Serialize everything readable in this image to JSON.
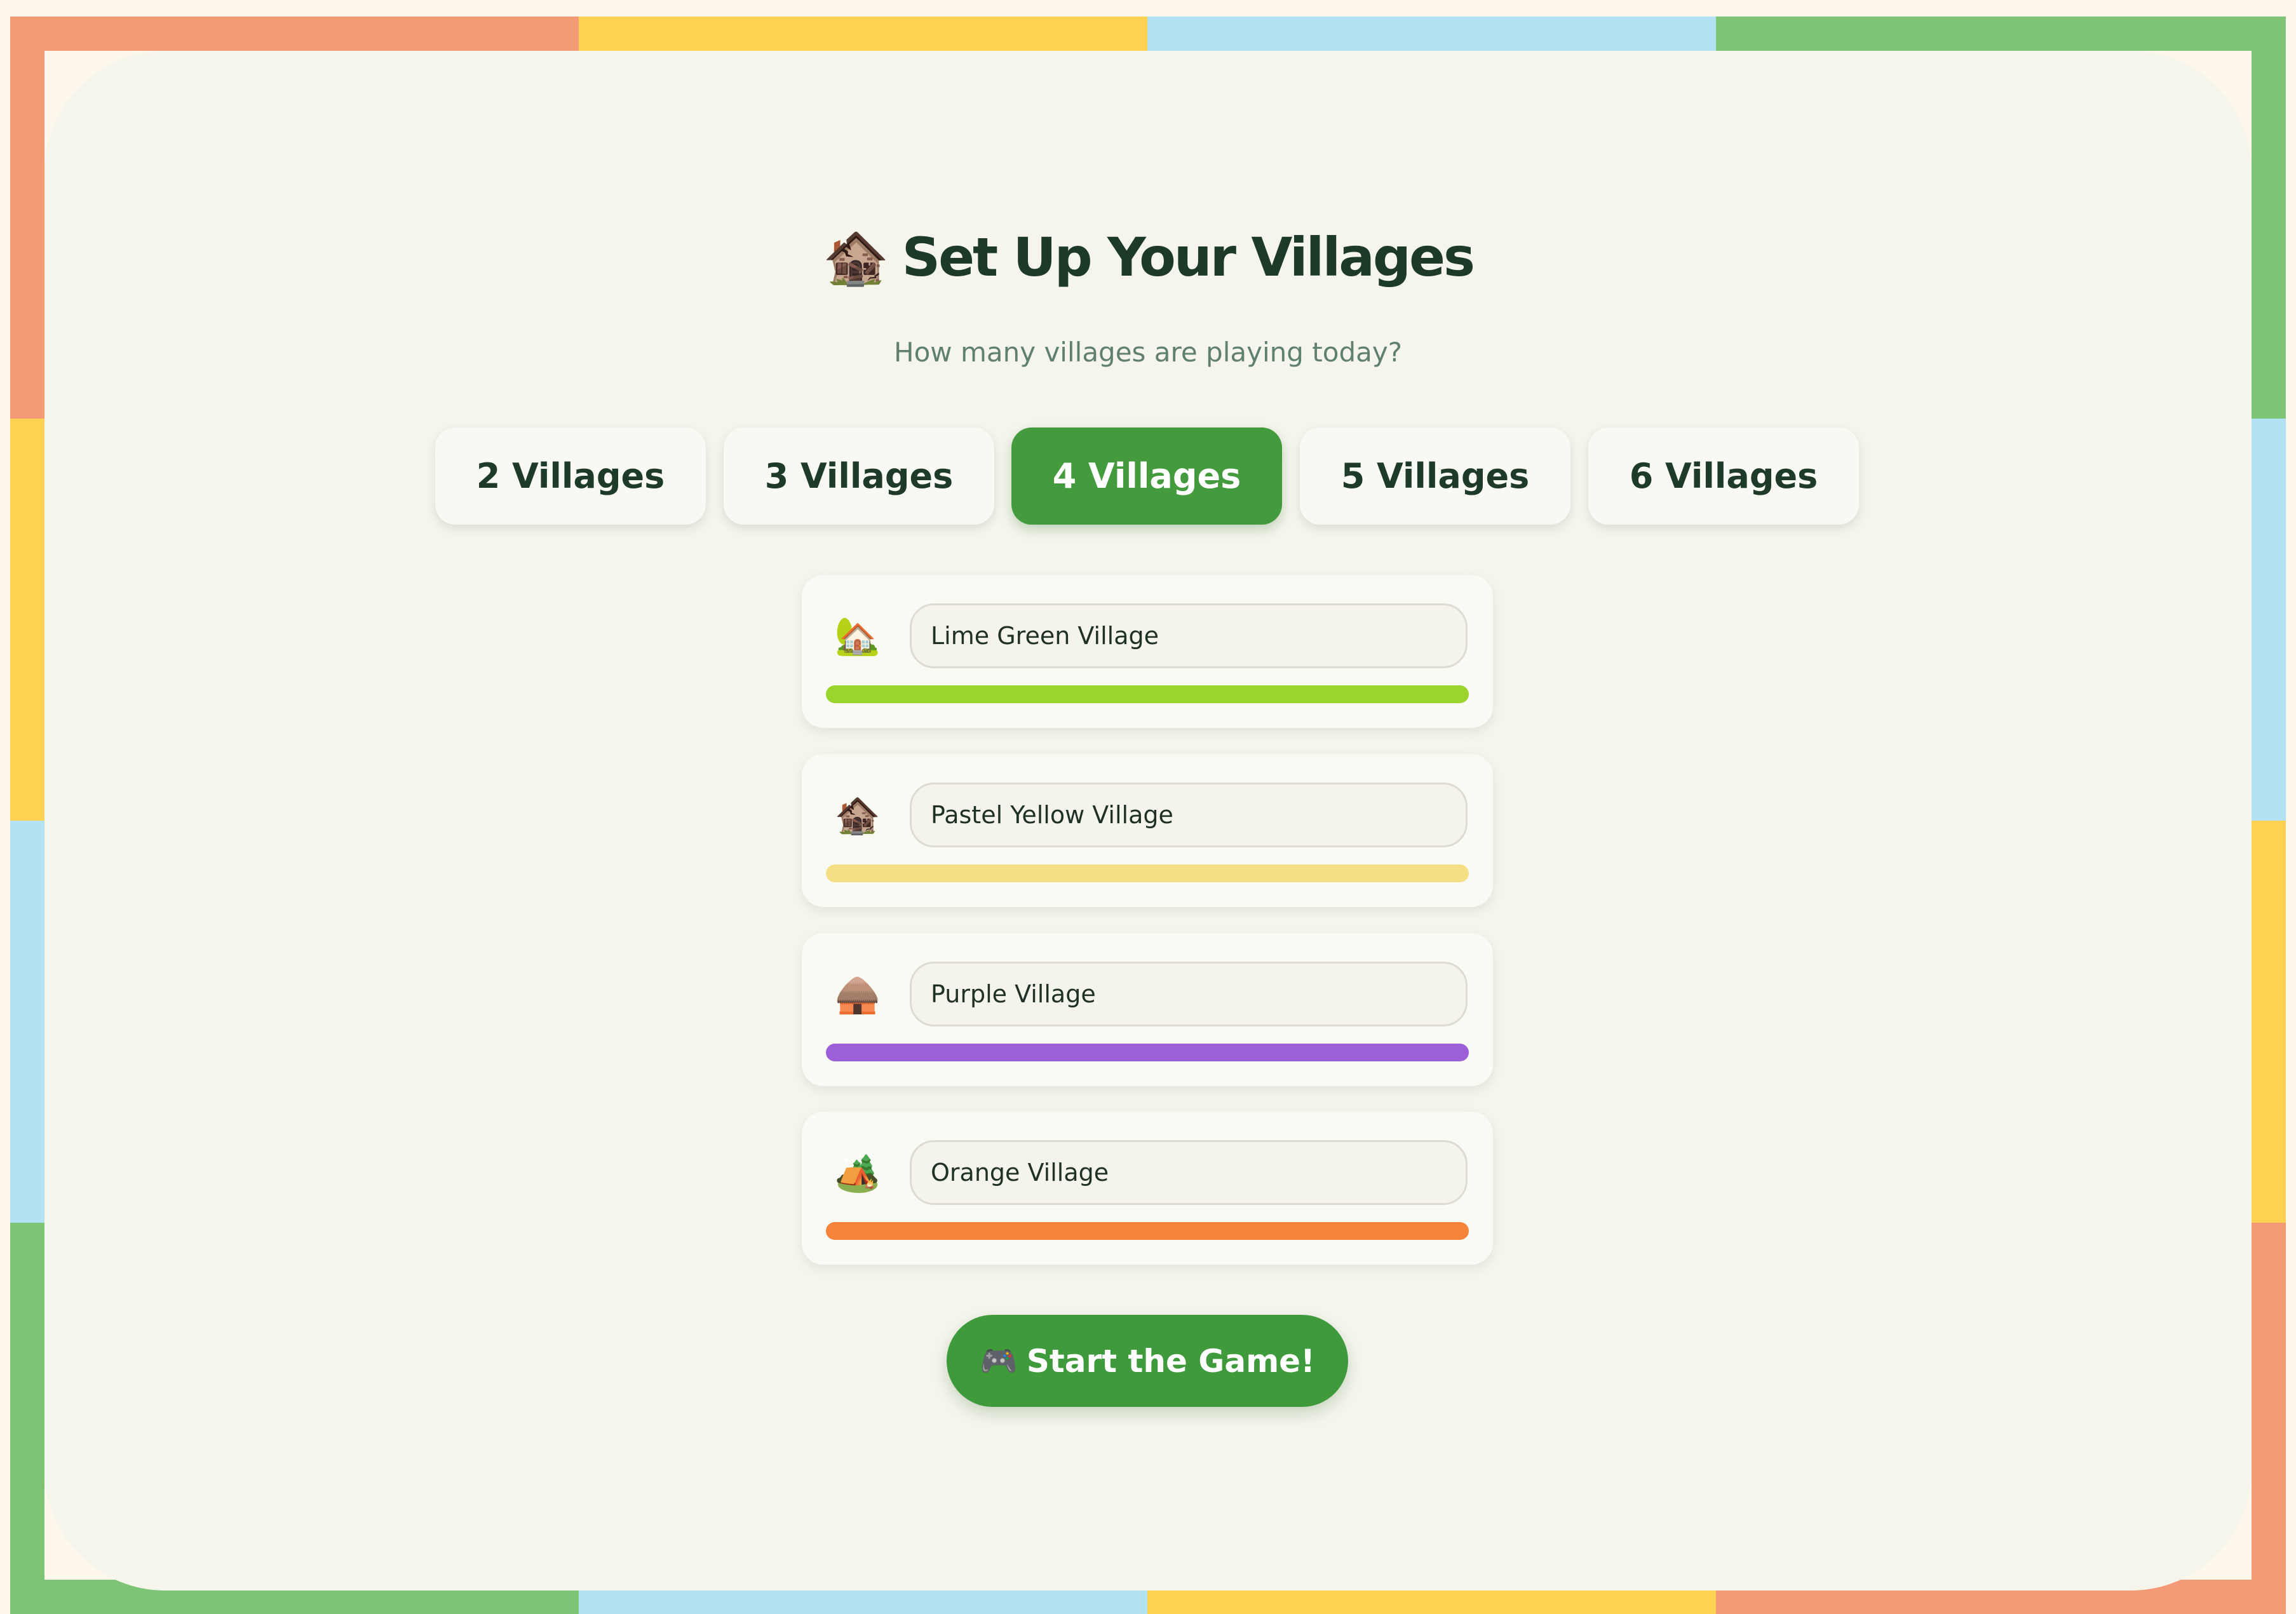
{
  "theme": {
    "coral": "#f59a76",
    "yellow": "#fdd253",
    "sky": "#b3e2f2",
    "green": "#7dc476",
    "panel": "#f5f5ec",
    "accent_green": "#439b3e"
  },
  "header": {
    "title_icon": "🏚️",
    "title": "Set Up Your Villages",
    "subtitle": "How many villages are playing today?"
  },
  "village_count": {
    "selected": "4 Villages",
    "options": [
      {
        "label": "2 Villages",
        "selected": false
      },
      {
        "label": "3 Villages",
        "selected": false
      },
      {
        "label": "4 Villages",
        "selected": true
      },
      {
        "label": "5 Villages",
        "selected": false
      },
      {
        "label": "6 Villages",
        "selected": false
      }
    ]
  },
  "villages": [
    {
      "icon": "🏡",
      "icon_name": "house-with-tree-icon",
      "name": "Lime Green Village",
      "color": "#9bd42c"
    },
    {
      "icon": "🏚️",
      "icon_name": "house-icon",
      "name": "Pastel Yellow Village",
      "color": "#f5df84"
    },
    {
      "icon": "🛖",
      "icon_name": "hut-icon",
      "name": "Purple Village",
      "color": "#9c5fd8"
    },
    {
      "icon": "🏕️",
      "icon_name": "camping-tent-icon",
      "name": "Orange Village",
      "color": "#f5843a"
    }
  ],
  "start": {
    "icon": "🎮",
    "label": "Start the Game!"
  }
}
